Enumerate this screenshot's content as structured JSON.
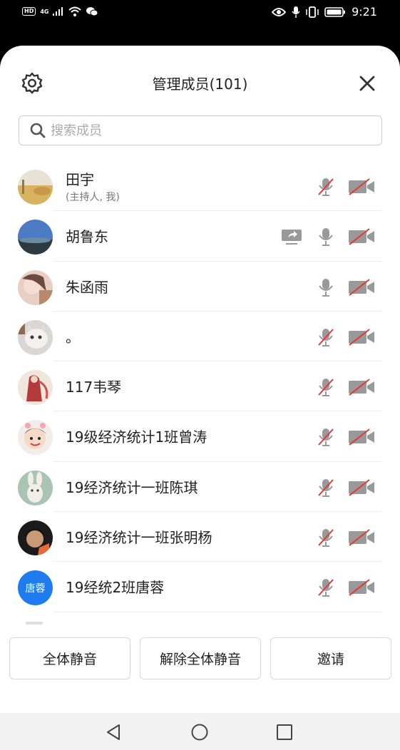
{
  "status_bar": {
    "hd": "HD",
    "network": "4G",
    "time": "9:21"
  },
  "header": {
    "title": "管理成员(101)",
    "settings_icon": "gear-icon",
    "close_icon": "close-icon"
  },
  "search": {
    "placeholder": "搜索成员",
    "value": ""
  },
  "members": [
    {
      "name": "田宇",
      "sub": "(主持人, 我)",
      "avatar": "landscape",
      "mic": "muted",
      "camera": "off",
      "sharing": false
    },
    {
      "name": "胡鲁东",
      "sub": "",
      "avatar": "sky",
      "mic": "on",
      "camera": "off",
      "sharing": true
    },
    {
      "name": "朱函雨",
      "sub": "",
      "avatar": "portrait",
      "mic": "on",
      "camera": "off",
      "sharing": false
    },
    {
      "name": "。",
      "sub": "",
      "avatar": "cat",
      "mic": "muted",
      "camera": "off",
      "sharing": false
    },
    {
      "name": "117韦琴",
      "sub": "",
      "avatar": "red-figure",
      "mic": "muted",
      "camera": "off",
      "sharing": false
    },
    {
      "name": "19级经济统计1班曾涛",
      "sub": "",
      "avatar": "child",
      "mic": "muted",
      "camera": "off",
      "sharing": false
    },
    {
      "name": "19经济统计一班陈琪",
      "sub": "",
      "avatar": "rabbit",
      "mic": "muted",
      "camera": "off",
      "sharing": false
    },
    {
      "name": "19经济统计一班张明杨",
      "sub": "",
      "avatar": "dark-portrait",
      "mic": "muted",
      "camera": "off",
      "sharing": false
    },
    {
      "name": "19经统2班唐蓉",
      "sub": "",
      "avatar_text": "唐蓉",
      "avatar": "text",
      "mic": "muted",
      "camera": "off",
      "sharing": false
    }
  ],
  "buttons": {
    "mute_all": "全体静音",
    "unmute_all": "解除全体静音",
    "invite": "邀请"
  },
  "colors": {
    "accent": "#1f7cf0",
    "muted_red": "#e53935",
    "icon_gray": "#888888"
  }
}
